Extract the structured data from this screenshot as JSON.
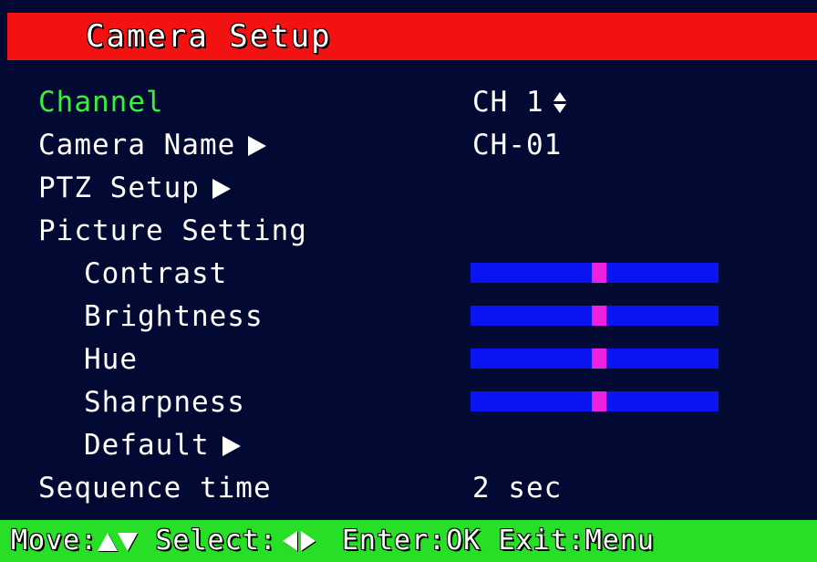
{
  "title": "Camera Setup",
  "menu": {
    "channel": {
      "label": "Channel",
      "value": "CH 1"
    },
    "camera_name": {
      "label": "Camera Name",
      "value": "CH-01"
    },
    "ptz_setup": {
      "label": "PTZ Setup"
    },
    "picture_setting": {
      "label": "Picture Setting"
    },
    "contrast": {
      "label": "Contrast",
      "level": 0.52
    },
    "brightness": {
      "label": "Brightness",
      "level": 0.52
    },
    "hue": {
      "label": "Hue",
      "level": 0.52
    },
    "sharpness": {
      "label": "Sharpness",
      "level": 0.52
    },
    "default": {
      "label": "Default"
    },
    "sequence_time": {
      "label": "Sequence time",
      "value": "2 sec"
    }
  },
  "footer": {
    "move": "Move:",
    "select": "Select:",
    "enter": "Enter:OK",
    "exit": "Exit:Menu"
  },
  "colors": {
    "title_bar": "#f21212",
    "background": "#020a33",
    "selected_text": "#38f23a",
    "slider_track": "#0a14f0",
    "slider_thumb": "#f020e0",
    "footer_bar": "#27df27"
  },
  "icons": {
    "submenu": "right-triangle-icon",
    "updown": "up-down-arrow-icon",
    "footer_move": [
      "up-triangle-icon",
      "down-triangle-icon"
    ],
    "footer_select": [
      "left-triangle-icon",
      "right-triangle-icon"
    ]
  }
}
